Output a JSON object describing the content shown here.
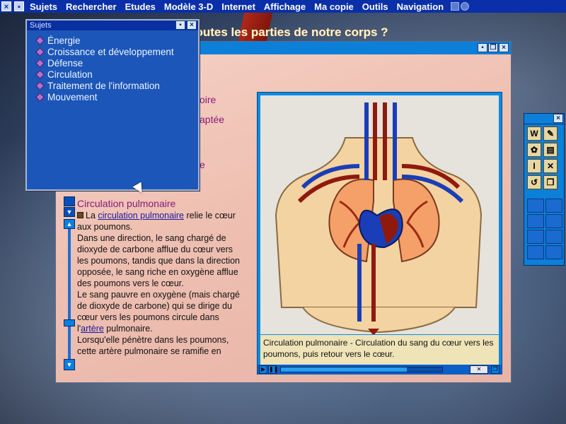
{
  "menubar": {
    "items": [
      "Sujets",
      "Rechercher",
      "Etudes",
      "Modèle 3-D",
      "Internet",
      "Affichage",
      "Ma copie",
      "Outils",
      "Navigation"
    ]
  },
  "sujets_window": {
    "title": "Sujets",
    "items": [
      "Énergie",
      "Croissance et développement",
      "Défense",
      "Circulation",
      "Traitement de l'information",
      "Mouvement"
    ]
  },
  "main_window": {
    "heading": "atteint-il toutes les parties de notre corps ?",
    "fragments": [
      "oire",
      "aptée",
      "e"
    ]
  },
  "article": {
    "title": "Circulation pulmonaire",
    "p1_before": "La ",
    "p1_link": "circulation pulmonaire",
    "p1_after": " relie le cœur aux poumons.",
    "p2": "Dans une direction, le sang chargé de dioxyde de carbone afflue du cœur vers les poumons, tandis que dans la direction opposée, le sang riche en oxygène afflue des poumons vers le cœur.",
    "p3_before": "Le sang pauvre en oxygène (mais chargé de dioxyde de carbone) qui se dirige du cœur vers les poumons circule dans l'",
    "p3_link": "artère",
    "p3_after": " pulmonaire.",
    "p4": "Lorsqu'elle pénètre dans les poumons, cette artère pulmonaire se ramifie en"
  },
  "image_panel": {
    "caption": "Circulation pulmonaire - Circulation du sang du cœur vers les poumons, puis retour vers le cœur.",
    "playback_progress_fraction": 0.78
  },
  "toolbox": {
    "buttons": [
      {
        "icon": "w-word-icon",
        "glyph": "W"
      },
      {
        "icon": "brush-icon",
        "glyph": "✎"
      },
      {
        "icon": "paint-icon",
        "glyph": "✿"
      },
      {
        "icon": "document-icon",
        "glyph": "▤"
      },
      {
        "icon": "info-icon",
        "glyph": "I"
      },
      {
        "icon": "sound-off-icon",
        "glyph": "✕"
      },
      {
        "icon": "refresh-icon",
        "glyph": "↺"
      },
      {
        "icon": "copy-icon",
        "glyph": "❐"
      }
    ]
  },
  "colors": {
    "menubar": "#0a2fa8",
    "panel_blue": "#0c7fd8",
    "artery_red": "#8e1a0e",
    "vein_blue": "#1a3eb8"
  }
}
